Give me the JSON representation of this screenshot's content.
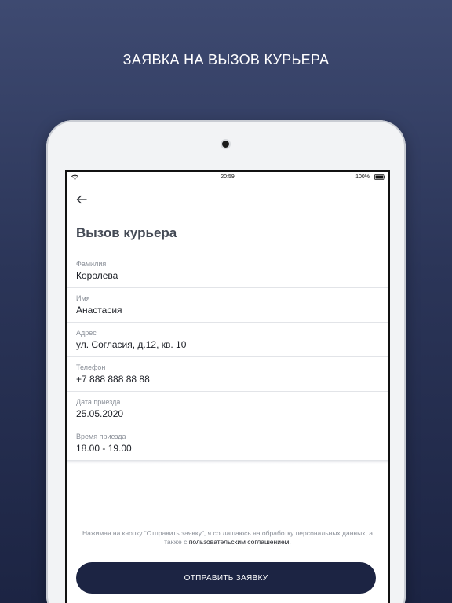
{
  "promo": {
    "title": "ЗАЯВКА НА ВЫЗОВ КУРЬЕРА"
  },
  "status_bar": {
    "time": "20:59",
    "battery": "100%",
    "icons": [
      "wifi-icon",
      "battery-icon"
    ]
  },
  "header": {
    "back_icon": "arrow-left-icon",
    "title": "Вызов курьера"
  },
  "form": {
    "fields": [
      {
        "label": "Фамилия",
        "value": "Королева"
      },
      {
        "label": "Имя",
        "value": "Анастасия"
      },
      {
        "label": "Адрес",
        "value": "ул. Согласия, д.12, кв. 10"
      },
      {
        "label": "Телефон",
        "value": "+7 888 888 88 88"
      },
      {
        "label": "Дата приезда",
        "value": "25.05.2020"
      },
      {
        "label": "Время приезда",
        "value": "18.00 - 19.00"
      }
    ]
  },
  "consent": {
    "text_before": "Нажимая на кнопку “Отправить заявку”, я соглашаюсь на обработку персональных данных, а также с ",
    "link": "пользовательским соглашением",
    "text_after": "."
  },
  "submit": {
    "label": "ОТПРАВИТЬ ЗАЯВКУ"
  },
  "colors": {
    "background_top": "#3e4a71",
    "background_bottom": "#1c2443",
    "button": "#1c2443"
  }
}
